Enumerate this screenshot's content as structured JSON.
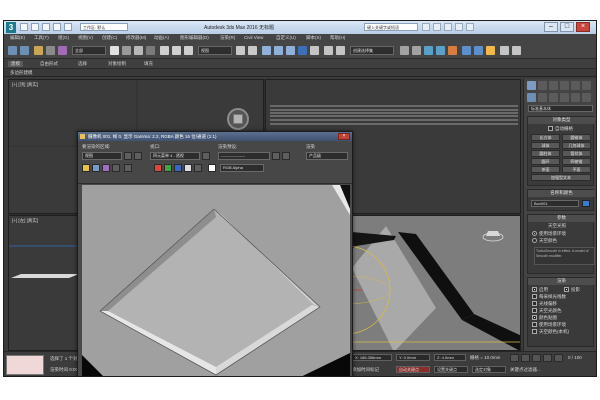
{
  "app": {
    "title": "Autodesk 3ds Max 2016    无标题",
    "workspace": "工作区: 默认",
    "search_placeholder": "键入关键字或短语"
  },
  "menu": [
    "编辑(E)",
    "工具(T)",
    "组(G)",
    "视图(V)",
    "创建(C)",
    "修改器(M)",
    "动画(A)",
    "图形编辑器(D)",
    "渲染(R)",
    "Civil View",
    "自定义(U)",
    "脚本(S)",
    "帮助(H)"
  ],
  "toolbar": {
    "filter": "全部",
    "view": "视图",
    "selection_set": "创建选择集"
  },
  "ribbon": {
    "tabs": [
      "建模",
      "自由形式",
      "选择",
      "对象绘制",
      "填充"
    ],
    "active_tab": "建模",
    "sub": "多边形建模"
  },
  "viewports": {
    "top_left": "[+] [顶] [真实]",
    "left": "[+] [左] [真实]"
  },
  "render_window": {
    "title": "摄像机 001, 帧 0, 显示 Gamma: 2.2, RGBA 颜色 16 位/通道 (1:1)",
    "area_label": "要渲染的区域:",
    "area_value": "视图",
    "viewport_label": "视口:",
    "viewport_value": "四元菜单 4 - 透视",
    "preset_label": "渲染预设:",
    "preset_value": "------------------",
    "render_label": "渲染",
    "render_value": "产品级",
    "channel_value": "RGB Alpha"
  },
  "cmd_panel": {
    "dropdown": "标准基本体",
    "object_type_header": "对象类型",
    "autogrid": "自动栅格",
    "buttons": [
      "长方体",
      "圆锥体",
      "球体",
      "几何球体",
      "圆柱体",
      "管状体",
      "圆环",
      "四棱锥",
      "茶壶",
      "平面",
      "加强型文本"
    ],
    "name_color_header": "名称和颜色",
    "object_name": "Box001",
    "params_header": "参数",
    "params_sub": "天空光照",
    "param_radios": [
      "使用场景环境",
      "天空颜色"
    ],
    "note": "TurboSmooth in effect. A model of Smooth modifier.",
    "render_header": "渲染",
    "render_opts": [
      {
        "label": "启用",
        "on": true
      },
      {
        "label": "投影",
        "on": true
      },
      {
        "label": "每采样光线数",
        "on": false
      },
      {
        "label": "光线偏移",
        "on": false
      },
      {
        "label": "天空光颜色",
        "on": false
      },
      {
        "label": "颜色贴图",
        "on": true
      },
      {
        "label": "使用场景环境",
        "on": false
      },
      {
        "label": "天空颜色(本机)",
        "on": false
      }
    ]
  },
  "status": {
    "selected": "选择了 1 个对象",
    "tip": "渲染时间 0:00:00",
    "x": "X: 186.356mm",
    "y": "Y: 0.0mm",
    "z": "Z: 4.0mm",
    "grid": "栅格 = 10.0mm",
    "add_time_tag": "添加时间标记",
    "auto_key": "自动关键点",
    "set_key": "设置关键点",
    "key_filter": "关键点过滤器...",
    "selected_obj": "选定对象",
    "frame": "0 / 100"
  }
}
